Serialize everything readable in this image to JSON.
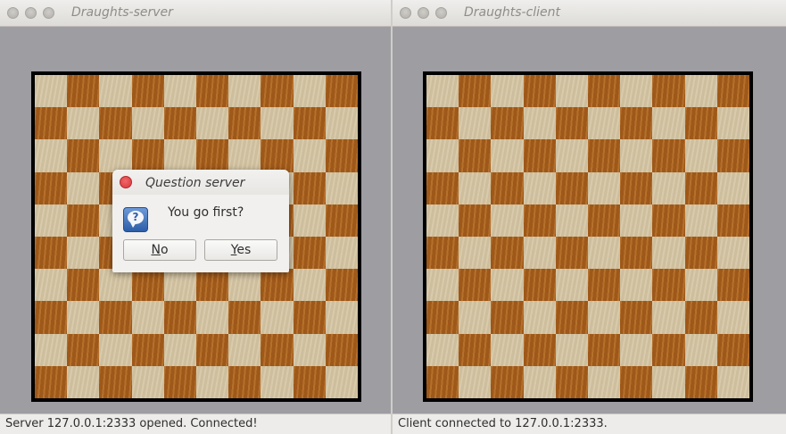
{
  "server_window": {
    "title": "Draughts-server",
    "status": "Server 127.0.0.1:2333 opened. Connected!"
  },
  "client_window": {
    "title": "Draughts-client",
    "status": "Client connected to 127.0.0.1:2333."
  },
  "board": {
    "size": 10,
    "light_color": "#d4c4a2",
    "dark_color": "#a95f1c"
  },
  "dialog": {
    "title": "Question server",
    "message": "You go first?",
    "icon": "question-icon",
    "no_label": "No",
    "yes_label": "Yes",
    "close_color": "#e0393e"
  }
}
